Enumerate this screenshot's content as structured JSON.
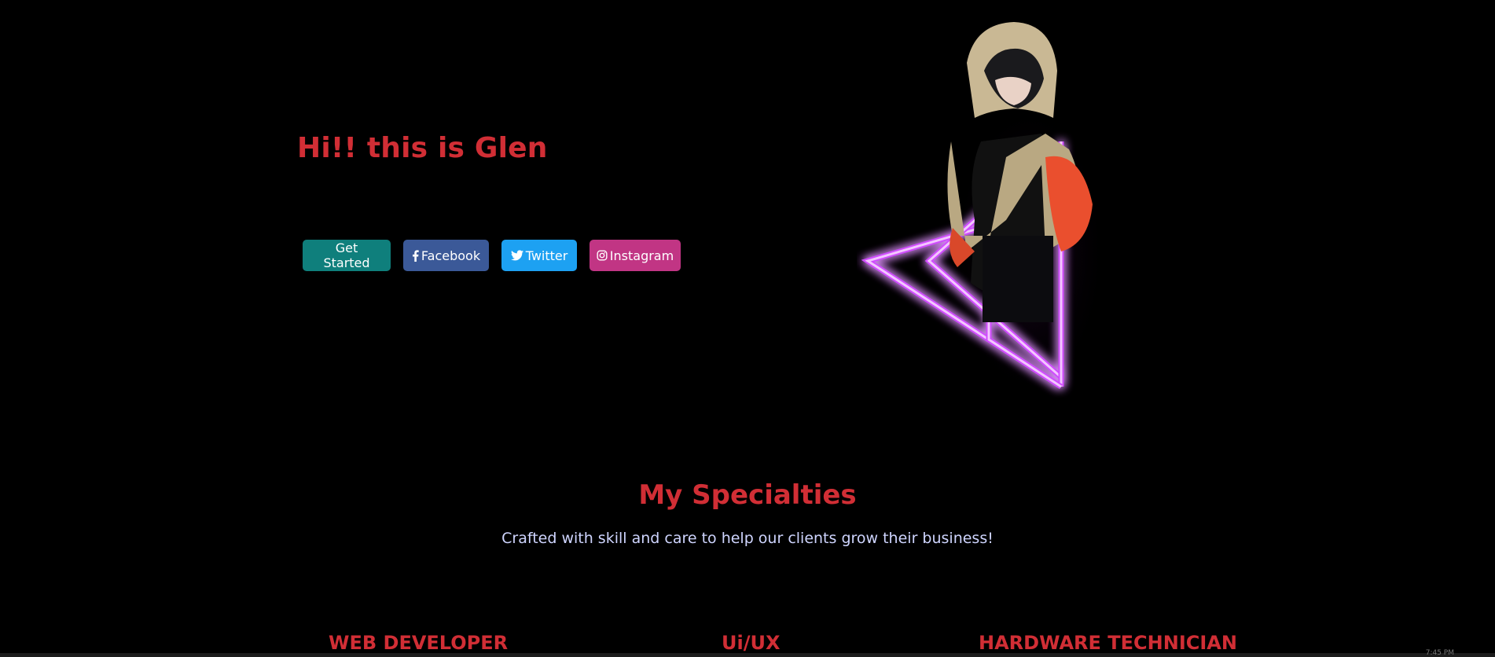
{
  "hero": {
    "title": "Hi!! this is Glen",
    "buttons": {
      "get_started": "Get Started",
      "facebook": "Facebook",
      "twitter": "Twitter",
      "instagram": "Instagram"
    }
  },
  "specialties": {
    "title": "My Specialties",
    "subtitle": "Crafted with skill and care to help our clients grow their business!",
    "items": [
      "WEB DEVELOPER",
      "Ui/UX",
      "HARDWARE TECHNICIAN"
    ]
  },
  "taskbar": {
    "clock": "7:45 PM"
  },
  "colors": {
    "accent_red": "#d12e35",
    "neon": "#c838ff",
    "facebook": "#3b5998",
    "twitter": "#1da1f2",
    "instagram": "#c13584",
    "get_started": "#0f7f7c"
  },
  "icons": [
    "facebook-icon",
    "twitter-icon",
    "instagram-icon"
  ]
}
